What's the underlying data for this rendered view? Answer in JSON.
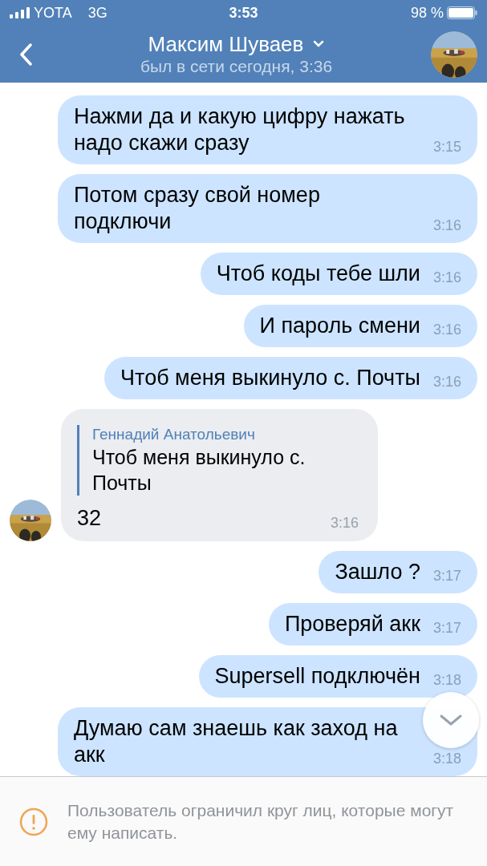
{
  "status_bar": {
    "carrier": "YOTA",
    "network": "3G",
    "time": "3:53",
    "battery": "98 %"
  },
  "header": {
    "name": "Максим Шуваев",
    "last_seen": "был в сети сегодня, 3:36"
  },
  "messages": [
    {
      "kind": "outgoing",
      "text": "Нажми да и какую цифру нажать надо скажи сразу",
      "time": "3:15"
    },
    {
      "kind": "outgoing",
      "text": "Потом сразу свой номер подключи",
      "time": "3:16"
    },
    {
      "kind": "outgoing",
      "text": "Чтоб коды тебе шли",
      "time": "3:16"
    },
    {
      "kind": "outgoing",
      "text": "И пароль смени",
      "time": "3:16"
    },
    {
      "kind": "outgoing",
      "text": "Чтоб меня выкинуло с. Почты",
      "time": "3:16"
    },
    {
      "kind": "incoming",
      "reply": {
        "author": "Геннадий Анатольевич",
        "text": "Чтоб меня выкинуло с. Почты"
      },
      "text": "32",
      "time": "3:16"
    },
    {
      "kind": "outgoing",
      "text": "Зашло ?",
      "time": "3:17"
    },
    {
      "kind": "outgoing",
      "text": "Проверяй акк",
      "time": "3:17"
    },
    {
      "kind": "outgoing",
      "text": "Supersell подключён",
      "time": "3:18"
    },
    {
      "kind": "outgoing",
      "text": "Думаю сам знаешь как заход на акк",
      "time": "3:18"
    }
  ],
  "notice": "Пользователь ограничил круг лиц, которые могут ему написать."
}
